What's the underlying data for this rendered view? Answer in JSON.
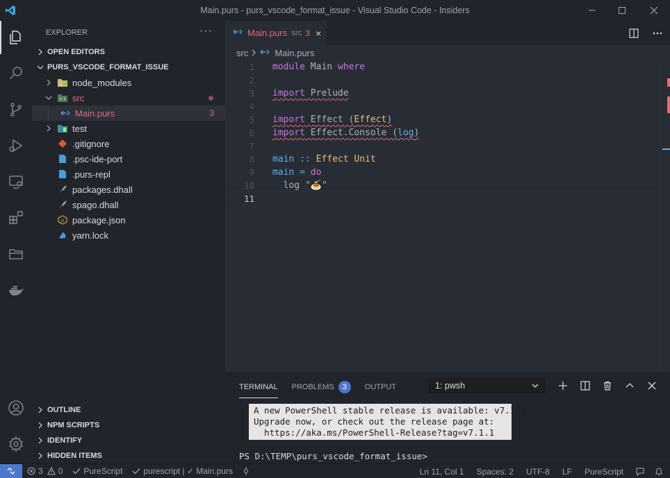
{
  "window": {
    "title": "Main.purs - purs_vscode_format_issue - Visual Studio Code - Insiders",
    "controls": [
      "minimize-icon",
      "maximize-icon",
      "close-icon"
    ]
  },
  "activity_bar": {
    "items": [
      "explorer",
      "search",
      "source-control",
      "run-debug",
      "remote-explorer",
      "extensions",
      "folder-view",
      "docker"
    ],
    "bottom": [
      "account",
      "settings"
    ]
  },
  "sidebar": {
    "header": "EXPLORER",
    "more": "···",
    "open_editors": "OPEN EDITORS",
    "folder": "PURS_VSCODE_FORMAT_ISSUE",
    "items": [
      {
        "label": "node_modules",
        "type": "folder"
      },
      {
        "label": "src",
        "type": "folder-open"
      },
      {
        "label": "Main.purs",
        "type": "file-purs",
        "badge": "3"
      },
      {
        "label": "test",
        "type": "folder"
      },
      {
        "label": ".gitignore",
        "type": "git"
      },
      {
        "label": ".psc-ide-port",
        "type": "file"
      },
      {
        "label": ".purs-repl",
        "type": "file"
      },
      {
        "label": "packages.dhall",
        "type": "dhall"
      },
      {
        "label": "spago.dhall",
        "type": "dhall"
      },
      {
        "label": "package.json",
        "type": "json"
      },
      {
        "label": "yarn.lock",
        "type": "yarn"
      }
    ],
    "bottom_sections": [
      "OUTLINE",
      "NPM SCRIPTS",
      "IDENTIFY",
      "HIDDEN ITEMS"
    ]
  },
  "editor": {
    "tab": {
      "name": "Main.purs",
      "dir": "src",
      "count": "3",
      "close": "×"
    },
    "breadcrumb": {
      "folder": "src",
      "file": "Main.purs"
    },
    "line_numbers": [
      "1",
      "2",
      "3",
      "4",
      "5",
      "6",
      "7",
      "8",
      "9",
      "10",
      "11"
    ],
    "code": {
      "l1": {
        "kw1": "module",
        "name": " Main ",
        "kw2": "where"
      },
      "l3": {
        "kw": "import",
        "mod": " Prelude"
      },
      "l5": {
        "kw": "import",
        "mod": " Effect ",
        "p1": "(",
        "ty": "Effect",
        "p2": ")"
      },
      "l6": {
        "kw": "import",
        "mod": " Effect.Console ",
        "p1": "(",
        "fn": "log",
        "p2": ")"
      },
      "l8": {
        "fn": "main",
        "op": " :: ",
        "ty": "Effect Unit"
      },
      "l9": {
        "fn": "main",
        "op": " = ",
        "kw": "do"
      },
      "l10": {
        "fn": "  log",
        "str": " \"🍝\""
      }
    }
  },
  "panel": {
    "tabs": [
      "TERMINAL",
      "PROBLEMS",
      "OUTPUT"
    ],
    "problems_count": "3",
    "terminal_select": "1: pwsh",
    "message_lines": [
      "A new PowerShell stable release is available: v7.1.1",
      "Upgrade now, or check out the release page at:",
      "  https://aka.ms/PowerShell-Release?tag=v7.1.1"
    ],
    "prompt": "PS D:\\TEMP\\purs_vscode_format_issue>"
  },
  "status_bar": {
    "errors": "3",
    "warnings": "0",
    "lang_status": "PureScript",
    "lsp_status": "purescript | ✓ Main.purs",
    "position": "Ln 11, Col 1",
    "spaces": "Spaces: 2",
    "encoding": "UTF-8",
    "eol": "LF",
    "language": "PureScript"
  },
  "colors": {
    "accent": "#4d78cc",
    "error": "#e06c75",
    "keyword": "#c678dd",
    "type": "#e5c07b",
    "function": "#61afef"
  }
}
